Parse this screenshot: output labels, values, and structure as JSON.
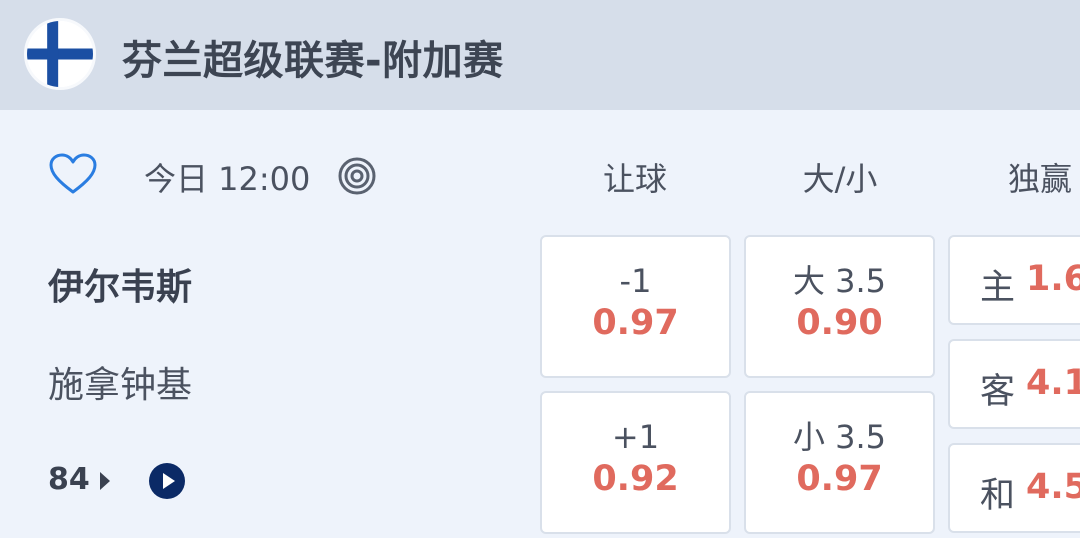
{
  "league": {
    "title": "芬兰超级联赛-附加赛",
    "flag_icon": "finland-flag-icon"
  },
  "match": {
    "time": "今日 12:00",
    "home_team": "伊尔韦斯",
    "away_team": "施拿钟基",
    "more_markets_count": "84",
    "favorite_icon": "heart-icon",
    "live_icon": "target-icon",
    "video_icon": "play-icon"
  },
  "columns": {
    "handicap": "让球",
    "over_under": "大/小",
    "win": "独赢"
  },
  "handicap": [
    {
      "line": "-1",
      "price": "0.97"
    },
    {
      "line": "+1",
      "price": "0.92"
    }
  ],
  "over_under": [
    {
      "line": "大 3.5",
      "price": "0.90"
    },
    {
      "line": "小 3.5",
      "price": "0.97"
    }
  ],
  "win": [
    {
      "label": "主",
      "price": "1.6"
    },
    {
      "label": "客",
      "price": "4.1"
    },
    {
      "label": "和",
      "price": "4.5"
    }
  ],
  "colors": {
    "header_bg": "#d6deea",
    "panel_bg": "#eef3fb",
    "odds_price": "#e06a5e",
    "accent_blue": "#2a7de1",
    "navy": "#0b2a66"
  }
}
